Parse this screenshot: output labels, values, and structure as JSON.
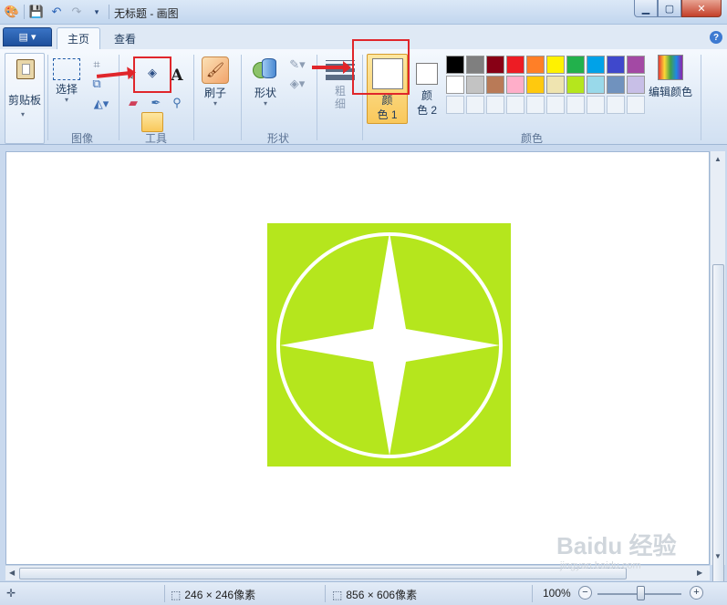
{
  "window": {
    "title": "无标题 - 画图"
  },
  "tabs": {
    "app_menu": "▤ ▾",
    "home": "主页",
    "view": "查看",
    "help": "?"
  },
  "ribbon": {
    "clipboard": {
      "paste_label": "剪贴板"
    },
    "image": {
      "select_label": "选择",
      "group_label": "图像"
    },
    "tools": {
      "group_label": "工具"
    },
    "brushes": {
      "label": "刷子"
    },
    "shapes": {
      "label": "形状",
      "group_label": "形状"
    },
    "size": {
      "label_line1": "粗",
      "label_line2": "细"
    },
    "colors": {
      "color1_line1": "颜",
      "color1_line2": "色 1",
      "color2_line1": "颜",
      "color2_line2": "色 2",
      "edit_label": "编辑颜色",
      "group_label": "颜色",
      "palette": [
        "#000000",
        "#7f7f7f",
        "#880015",
        "#ed1c24",
        "#ff7f27",
        "#fff200",
        "#22b14c",
        "#00a2e8",
        "#3f48cc",
        "#a349a4",
        "#ffffff",
        "#c3c3c3",
        "#b97a57",
        "#ffaec9",
        "#ffc90e",
        "#efe4b0",
        "#b5e61d",
        "#99d9ea",
        "#7092be",
        "#c8bfe7"
      ]
    }
  },
  "canvas": {
    "fill_color": "#b5e61d",
    "shape_color": "#ffffff"
  },
  "status": {
    "selection_size": "246 × 246像素",
    "canvas_size": "856 × 606像素",
    "zoom": "100%"
  },
  "watermark": {
    "brand": "Baidu 经验",
    "url": "jingyan.baidu.com"
  }
}
